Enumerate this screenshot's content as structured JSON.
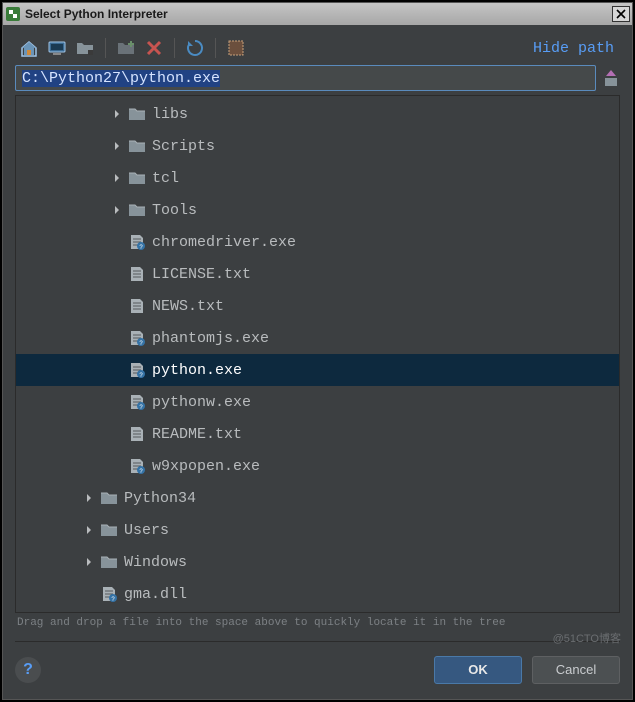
{
  "titlebar": {
    "title": "Select Python Interpreter"
  },
  "toolbar": {
    "hide_path_label": "Hide path"
  },
  "path": {
    "value": "C:\\Python27\\python.exe"
  },
  "tree": {
    "nodes": [
      {
        "indent": 2,
        "hasDisclosure": true,
        "expanded": false,
        "icon": "folder",
        "label": "libs",
        "selected": false
      },
      {
        "indent": 2,
        "hasDisclosure": true,
        "expanded": false,
        "icon": "folder",
        "label": "Scripts",
        "selected": false
      },
      {
        "indent": 2,
        "hasDisclosure": true,
        "expanded": false,
        "icon": "folder",
        "label": "tcl",
        "selected": false
      },
      {
        "indent": 2,
        "hasDisclosure": true,
        "expanded": false,
        "icon": "folder",
        "label": "Tools",
        "selected": false
      },
      {
        "indent": 2,
        "hasDisclosure": false,
        "expanded": false,
        "icon": "file-unknown",
        "label": "chromedriver.exe",
        "selected": false
      },
      {
        "indent": 2,
        "hasDisclosure": false,
        "expanded": false,
        "icon": "file-text",
        "label": "LICENSE.txt",
        "selected": false
      },
      {
        "indent": 2,
        "hasDisclosure": false,
        "expanded": false,
        "icon": "file-text",
        "label": "NEWS.txt",
        "selected": false
      },
      {
        "indent": 2,
        "hasDisclosure": false,
        "expanded": false,
        "icon": "file-unknown",
        "label": "phantomjs.exe",
        "selected": false
      },
      {
        "indent": 2,
        "hasDisclosure": false,
        "expanded": false,
        "icon": "file-unknown",
        "label": "python.exe",
        "selected": true
      },
      {
        "indent": 2,
        "hasDisclosure": false,
        "expanded": false,
        "icon": "file-unknown",
        "label": "pythonw.exe",
        "selected": false
      },
      {
        "indent": 2,
        "hasDisclosure": false,
        "expanded": false,
        "icon": "file-text",
        "label": "README.txt",
        "selected": false
      },
      {
        "indent": 2,
        "hasDisclosure": false,
        "expanded": false,
        "icon": "file-unknown",
        "label": "w9xpopen.exe",
        "selected": false
      },
      {
        "indent": 1,
        "hasDisclosure": true,
        "expanded": false,
        "icon": "folder",
        "label": "Python34",
        "selected": false
      },
      {
        "indent": 1,
        "hasDisclosure": true,
        "expanded": false,
        "icon": "folder",
        "label": "Users",
        "selected": false
      },
      {
        "indent": 1,
        "hasDisclosure": true,
        "expanded": false,
        "icon": "folder",
        "label": "Windows",
        "selected": false
      },
      {
        "indent": 1,
        "hasDisclosure": false,
        "expanded": false,
        "icon": "file-unknown",
        "label": "gma.dll",
        "selected": false
      }
    ]
  },
  "hint": {
    "text": "Drag and drop a file into the space above to quickly locate it in the tree"
  },
  "footer": {
    "ok_label": "OK",
    "cancel_label": "Cancel",
    "help_label": "?"
  },
  "watermark": {
    "text": "@51CTO博客"
  }
}
